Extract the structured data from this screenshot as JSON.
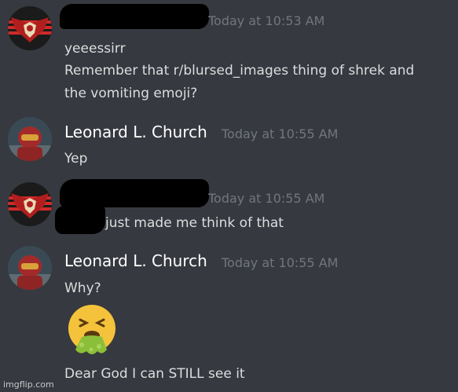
{
  "messages": [
    {
      "author": "",
      "timestamp": "Today at 10:53 AM",
      "lines": [
        "yeeessirr",
        "Remember that r/blursed_images thing of shrek and",
        "the vomiting emoji?"
      ]
    },
    {
      "author": "Leonard L. Church",
      "timestamp": "Today at 10:55 AM",
      "lines": [
        "Yep"
      ]
    },
    {
      "author": "",
      "timestamp": "Today at 10:55 AM",
      "lines": [
        "just made me think of that"
      ]
    },
    {
      "author": "Leonard L. Church",
      "timestamp": "Today at 10:55 AM",
      "lines": [
        "Why?",
        "Dear God I can STILL see it"
      ],
      "emoji": "face-vomiting-emoji"
    }
  ],
  "watermark": "imgflip.com",
  "colors": {
    "background": "#36393f",
    "username": "#ffffff",
    "message_text": "#dcddde",
    "timestamp": "#72767d",
    "redaction": "#000000"
  },
  "icons": {
    "arstotzka_avatar": "eagle-emblem-icon",
    "church_avatar": "red-armor-helmet-icon"
  }
}
